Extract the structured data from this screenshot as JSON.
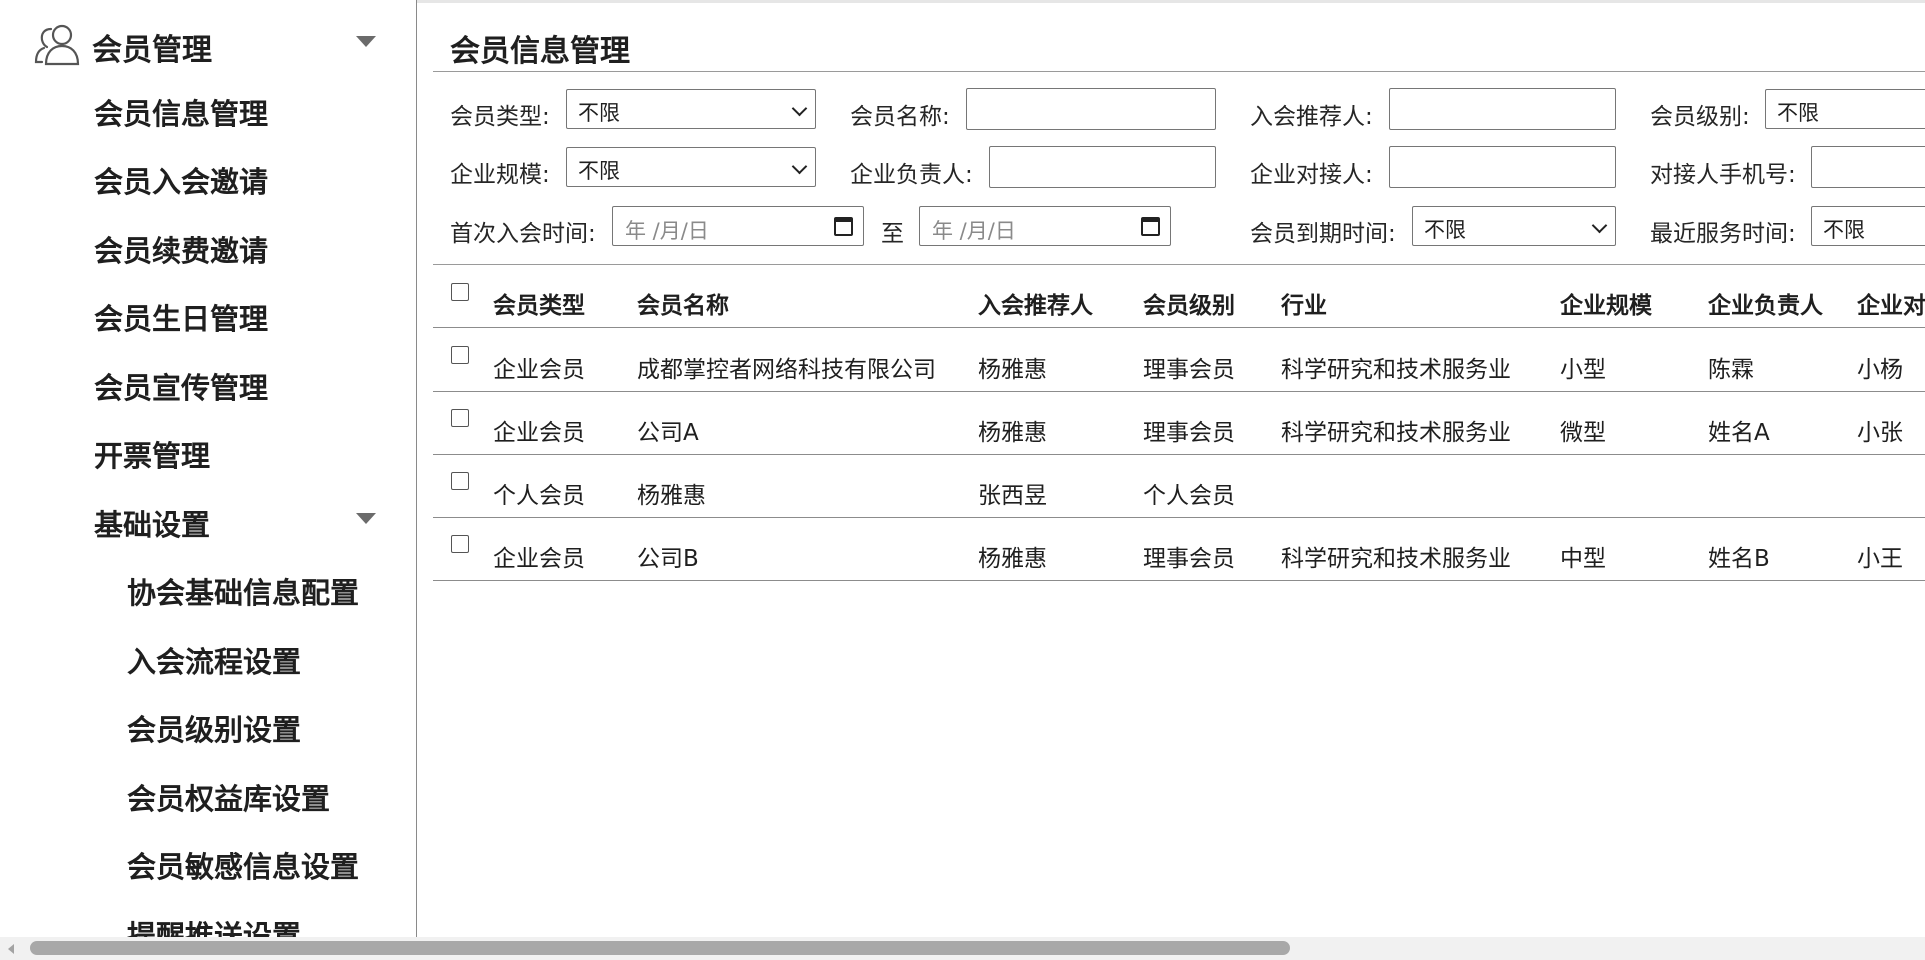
{
  "sidebar": {
    "root": {
      "label": "会员管理"
    },
    "items": [
      {
        "label": "会员信息管理"
      },
      {
        "label": "会员入会邀请"
      },
      {
        "label": "会员续费邀请"
      },
      {
        "label": "会员生日管理"
      },
      {
        "label": "会员宣传管理"
      },
      {
        "label": "开票管理"
      },
      {
        "label": "基础设置"
      }
    ],
    "sub_items": [
      {
        "label": "协会基础信息配置"
      },
      {
        "label": "入会流程设置"
      },
      {
        "label": "会员级别设置"
      },
      {
        "label": "会员权益库设置"
      },
      {
        "label": "会员敏感信息设置"
      },
      {
        "label": "提醒推送设置"
      }
    ]
  },
  "main": {
    "title": "会员信息管理",
    "filters": {
      "member_type": {
        "label": "会员类型:",
        "value": "不限"
      },
      "member_name": {
        "label": "会员名称:",
        "value": ""
      },
      "recommender": {
        "label": "入会推荐人:",
        "value": ""
      },
      "member_level": {
        "label": "会员级别:",
        "value": "不限"
      },
      "company_scale": {
        "label": "企业规模:",
        "value": "不限"
      },
      "company_leader": {
        "label": "企业负责人:",
        "value": ""
      },
      "company_contact": {
        "label": "企业对接人:",
        "value": ""
      },
      "contact_phone": {
        "label": "对接人手机号:",
        "value": ""
      },
      "first_join": {
        "label": "首次入会时间:",
        "from_placeholder": "年 /月/日",
        "to_label": "至",
        "to_placeholder": "年 /月/日"
      },
      "expire_time": {
        "label": "会员到期时间:",
        "value": "不限"
      },
      "recent_service": {
        "label": "最近服务时间:",
        "value": "不限"
      }
    },
    "table": {
      "headers": [
        "会员类型",
        "会员名称",
        "入会推荐人",
        "会员级别",
        "行业",
        "企业规模",
        "企业负责人",
        "企业对"
      ],
      "rows": [
        [
          "企业会员",
          "成都掌控者网络科技有限公司",
          "杨雅惠",
          "理事会员",
          "科学研究和技术服务业",
          "小型",
          "陈霖",
          "小杨"
        ],
        [
          "企业会员",
          "公司A",
          "杨雅惠",
          "理事会员",
          "科学研究和技术服务业",
          "微型",
          "姓名A",
          "小张"
        ],
        [
          "个人会员",
          "杨雅惠",
          "张西昱",
          "个人会员",
          "",
          "",
          "",
          ""
        ],
        [
          "企业会员",
          "公司B",
          "杨雅惠",
          "理事会员",
          "科学研究和技术服务业",
          "中型",
          "姓名B",
          "小王"
        ]
      ]
    }
  }
}
